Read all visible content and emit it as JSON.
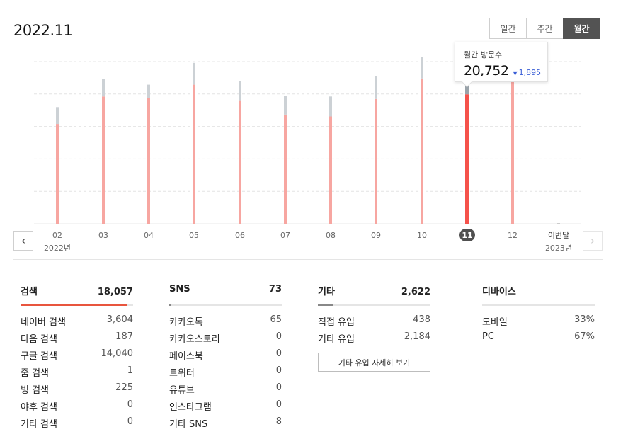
{
  "page": {
    "title": "2022.11"
  },
  "range_tabs": [
    {
      "label": "일간",
      "active": false
    },
    {
      "label": "주간",
      "active": false
    },
    {
      "label": "월간",
      "active": true
    }
  ],
  "tooltip": {
    "label": "월간 방문수",
    "value": "20,752",
    "change": "1,895",
    "change_direction": "down"
  },
  "chart_data": {
    "type": "bar",
    "categories": [
      "02",
      "03",
      "04",
      "05",
      "06",
      "07",
      "08",
      "09",
      "10",
      "11",
      "12",
      "이번달"
    ],
    "year_labels": {
      "first": "2022년",
      "last": "2023년"
    },
    "selected_index": 9,
    "series": [
      {
        "values": [
          16000,
          20400,
          20100,
          22300,
          19800,
          17500,
          17200,
          20000,
          23300,
          20752,
          22900,
          0
        ]
      },
      {
        "values": [
          2700,
          2800,
          2200,
          3500,
          3100,
          3000,
          3200,
          3700,
          3400,
          2900,
          3000,
          0
        ]
      }
    ],
    "ylim": [
      0,
      26000
    ],
    "grid": true,
    "colors": {
      "primary": "#f7a6a1",
      "primary_selected": "#f5524b",
      "secondary": "#ccd1d5",
      "secondary_selected": "#9aa3aa"
    }
  },
  "stats": [
    {
      "name": "검색",
      "total": "18,057",
      "fill": 0.95,
      "color": "#e8553e",
      "rows": [
        {
          "label": "네이버 검색",
          "value": "3,604"
        },
        {
          "label": "다음 검색",
          "value": "187"
        },
        {
          "label": "구글 검색",
          "value": "14,040"
        },
        {
          "label": "줌 검색",
          "value": "1"
        },
        {
          "label": "빙 검색",
          "value": "225"
        },
        {
          "label": "야후 검색",
          "value": "0"
        },
        {
          "label": "기타 검색",
          "value": "0"
        }
      ]
    },
    {
      "name": "SNS",
      "total": "73",
      "fill": 0.02,
      "color": "#888888",
      "rows": [
        {
          "label": "카카오톡",
          "value": "65"
        },
        {
          "label": "카카오스토리",
          "value": "0"
        },
        {
          "label": "페이스북",
          "value": "0"
        },
        {
          "label": "트위터",
          "value": "0"
        },
        {
          "label": "유튜브",
          "value": "0"
        },
        {
          "label": "인스타그램",
          "value": "0"
        },
        {
          "label": "기타 SNS",
          "value": "8"
        }
      ]
    },
    {
      "name": "기타",
      "total": "2,622",
      "fill": 0.14,
      "color": "#888888",
      "rows": [
        {
          "label": "직접 유입",
          "value": "438"
        },
        {
          "label": "기타 유입",
          "value": "2,184"
        }
      ],
      "detail_button": "기타 유입 자세히 보기"
    },
    {
      "name": "디바이스",
      "total": "",
      "fill": 0,
      "color": "#888888",
      "rows": [
        {
          "label": "모바일",
          "value": "33%"
        },
        {
          "label": "PC",
          "value": "67%"
        }
      ]
    }
  ]
}
